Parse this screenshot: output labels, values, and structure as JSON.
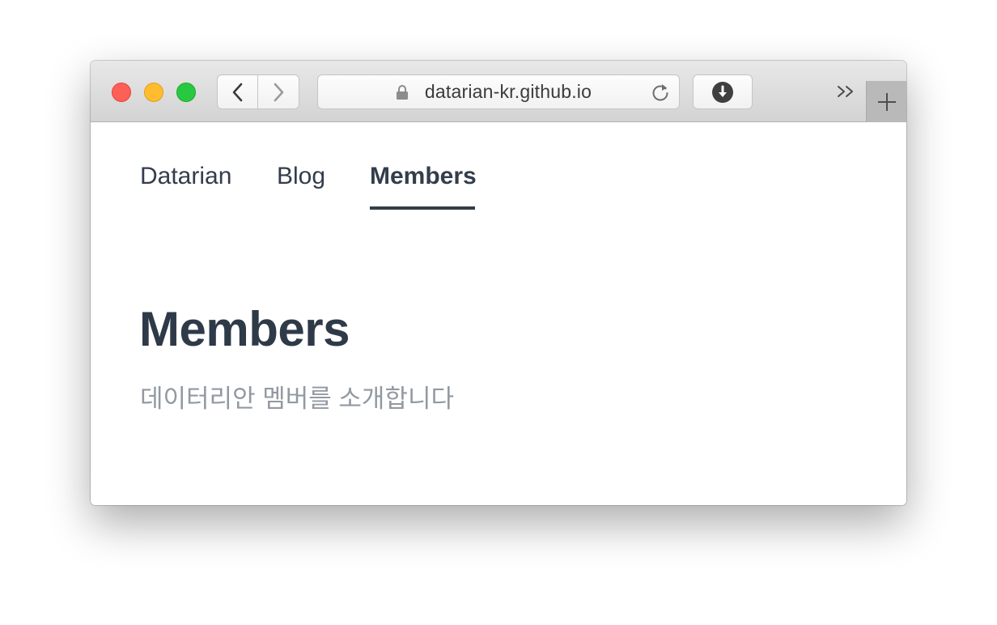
{
  "browser": {
    "url": "datarian-kr.github.io"
  },
  "nav": {
    "items": [
      {
        "label": "Datarian"
      },
      {
        "label": "Blog"
      },
      {
        "label": "Members",
        "active": true
      }
    ]
  },
  "page": {
    "title": "Members",
    "subtitle": "데이터리안 멤버를 소개합니다"
  },
  "icons": {
    "back": "chevron-left-icon",
    "forward": "chevron-right-icon",
    "lock": "lock-icon",
    "reload": "reload-icon",
    "download": "download-icon",
    "overflow": "chevron-double-right-icon",
    "new_tab": "plus-icon"
  },
  "colors": {
    "traffic_close": "#fe5f57",
    "traffic_minimize": "#febc2e",
    "traffic_maximize": "#28c840",
    "text_primary": "#333d4b",
    "text_secondary": "#9399a1"
  }
}
